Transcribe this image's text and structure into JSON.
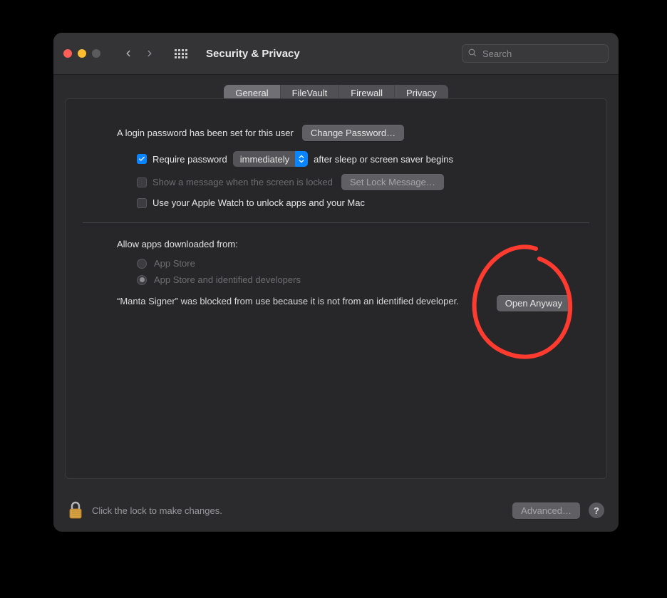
{
  "window_title": "Security & Privacy",
  "search": {
    "placeholder": "Search"
  },
  "tabs": {
    "general": "General",
    "filevault": "FileVault",
    "firewall": "Firewall",
    "privacy": "Privacy"
  },
  "general": {
    "login_password_set": "A login password has been set for this user",
    "change_password_btn": "Change Password…",
    "require_password_prefix": "Require password",
    "require_password_delay": "immediately",
    "require_password_suffix": "after sleep or screen saver begins",
    "show_message": "Show a message when the screen is locked",
    "set_lock_message_btn": "Set Lock Message…",
    "apple_watch": "Use your Apple Watch to unlock apps and your Mac",
    "allow_apps_label": "Allow apps downloaded from:",
    "allow_option_appstore": "App Store",
    "allow_option_identified": "App Store and identified developers",
    "blocked_message": "“Manta Signer” was blocked from use because it is not from an identified developer.",
    "open_anyway_btn": "Open Anyway"
  },
  "footer": {
    "lock_hint": "Click the lock to make changes.",
    "advanced_btn": "Advanced…"
  },
  "annotation": {
    "color": "#ff3b30"
  }
}
